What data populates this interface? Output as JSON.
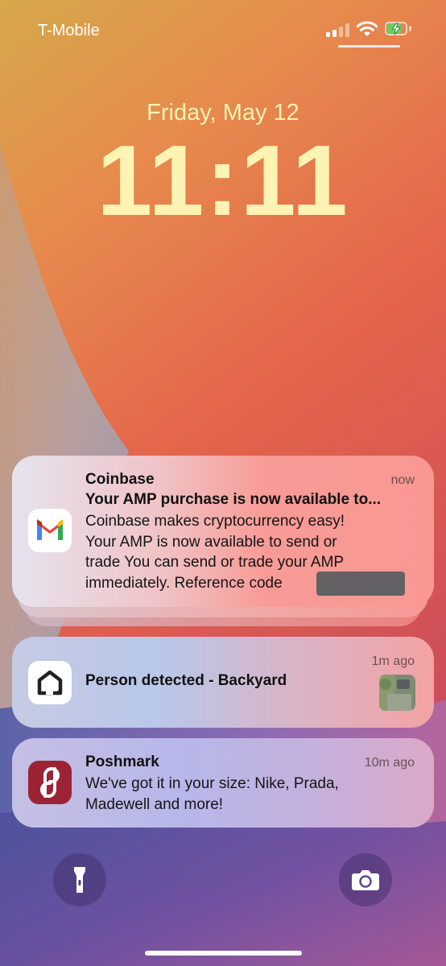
{
  "status_bar": {
    "carrier": "T-Mobile",
    "signal_icon": "cellular-signal-icon",
    "wifi_icon": "wifi-icon",
    "battery_icon": "battery-charging-icon"
  },
  "lock_screen": {
    "date": "Friday, May 12",
    "time": "11:11"
  },
  "notifications": [
    {
      "app": "Gmail",
      "icon": "gmail-icon",
      "title": "Coinbase",
      "time": "now",
      "subject": "Your AMP purchase is now available to...",
      "body_lines": [
        "Coinbase makes cryptocurrency easy!",
        "Your AMP is now available to send or",
        "trade You can send or trade your AMP",
        "immediately. Reference code"
      ]
    },
    {
      "app": "Home",
      "icon": "home-app-icon",
      "title": "Person detected - Backyard",
      "time": "1m ago"
    },
    {
      "app": "Poshmark",
      "icon": "poshmark-icon",
      "title": "Poshmark",
      "time": "10m ago",
      "body_lines": [
        "We've got it in your size: Nike, Prada,",
        "Madewell and more!"
      ]
    }
  ],
  "bottom": {
    "flashlight_icon": "flashlight-icon",
    "camera_icon": "camera-icon"
  },
  "colors": {
    "clock": "#fdf3b3",
    "gmail_red": "#ea4335",
    "poshmark": "#9b2334"
  }
}
